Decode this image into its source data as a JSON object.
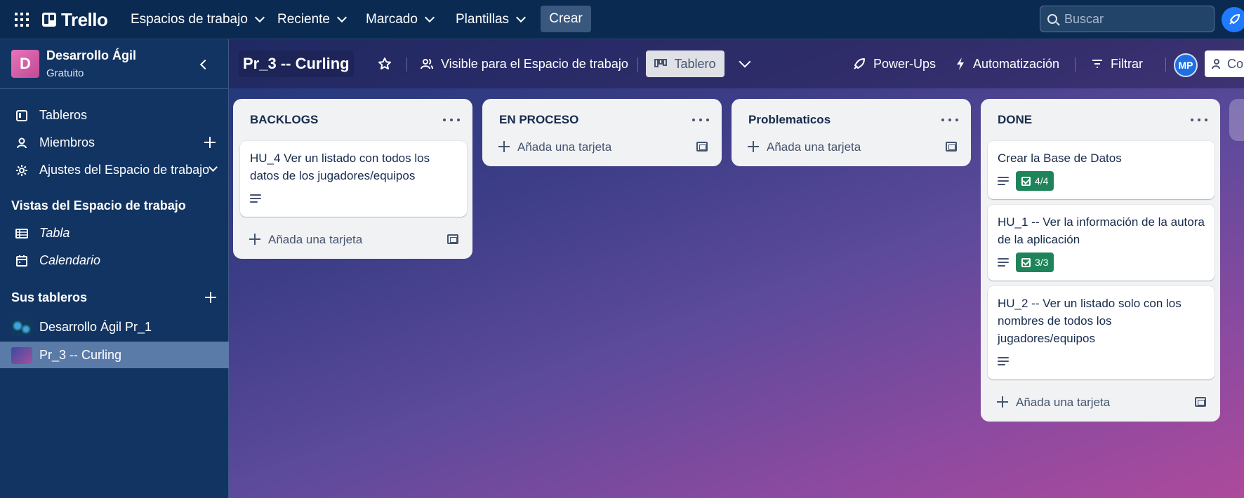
{
  "topbar": {
    "logo": "Trello",
    "nav": [
      "Espacios de trabajo",
      "Reciente",
      "Marcado",
      "Plantillas"
    ],
    "create": "Crear",
    "search_placeholder": "Buscar"
  },
  "sidebar": {
    "workspace_initial": "D",
    "workspace_name": "Desarrollo Ágil",
    "workspace_plan": "Gratuito",
    "items": [
      {
        "label": "Tableros",
        "icon": "board-icon"
      },
      {
        "label": "Miembros",
        "icon": "person-icon"
      },
      {
        "label": "Ajustes del Espacio de trabajo",
        "icon": "gear-icon"
      }
    ],
    "views_title": "Vistas del Espacio de trabajo",
    "views": [
      {
        "label": "Tabla",
        "icon": "table-icon"
      },
      {
        "label": "Calendario",
        "icon": "calendar-icon"
      }
    ],
    "boards_title": "Sus tableros",
    "boards": [
      {
        "label": "Desarrollo Ágil Pr_1",
        "active": false
      },
      {
        "label": "Pr_3 -- Curling",
        "active": true
      }
    ]
  },
  "board": {
    "title": "Pr_3 -- Curling",
    "visibility": "Visible para el Espacio de trabajo",
    "view": "Tablero",
    "powerups": "Power-Ups",
    "automation": "Automatización",
    "filter": "Filtrar",
    "member_initials": "MP",
    "share_label": "Co",
    "add_card_label": "Añada una tarjeta",
    "lists": [
      {
        "title": "BACKLOGS",
        "cards": [
          {
            "title": "HU_4 Ver un listado con todos los datos de los jugadores/equipos",
            "description": true,
            "checklist": null
          }
        ]
      },
      {
        "title": "EN PROCESO",
        "cards": []
      },
      {
        "title": "Problematicos",
        "cards": []
      },
      {
        "title": "DONE",
        "cards": [
          {
            "title": "Crear la Base de Datos",
            "description": true,
            "checklist": "4/4"
          },
          {
            "title": "HU_1 -- Ver la información de la autora de la aplicación",
            "description": true,
            "checklist": "3/3"
          },
          {
            "title": "HU_2 -- Ver un listado solo con los nombres de todos los jugadores/equipos",
            "description": true,
            "checklist": null
          }
        ]
      }
    ]
  },
  "colors": {
    "topbar": "#0b2a52",
    "sidebar": "#123462",
    "checklist_complete": "#1f845a",
    "list_bg": "#f1f2f4"
  }
}
